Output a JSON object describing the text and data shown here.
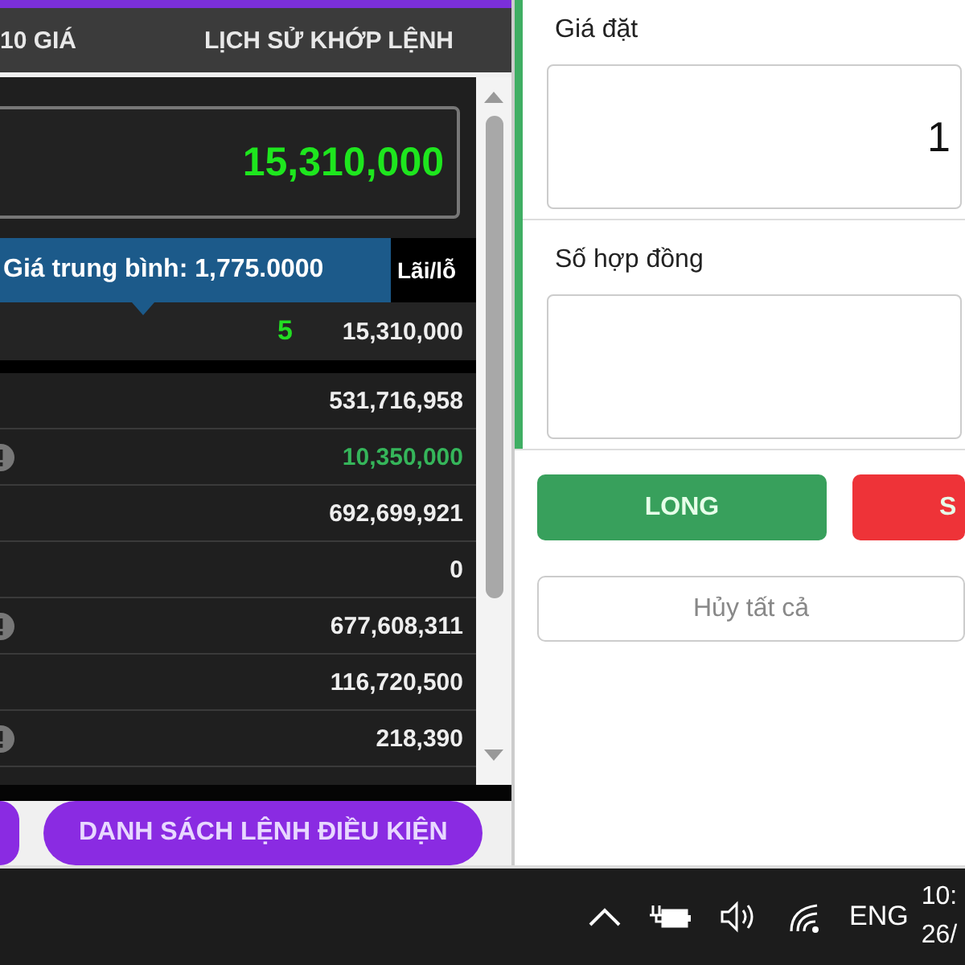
{
  "left_panel": {
    "tabs": [
      {
        "label": "10 GIÁ"
      },
      {
        "label": "LỊCH SỬ KHỚP LỆNH"
      }
    ],
    "total_value": "15,310,000",
    "tooltip": "Giá trung bình: 1,775.0000",
    "column_header": "Lãi/lỗ",
    "position_row": {
      "quantity": "5",
      "value": "15,310,000"
    },
    "rows": [
      {
        "info": false,
        "value": "531,716,958",
        "kind": "plain"
      },
      {
        "info": true,
        "value": "10,350,000",
        "kind": "gain"
      },
      {
        "info": false,
        "value": "692,699,921",
        "kind": "plain"
      },
      {
        "info": false,
        "value": "0",
        "kind": "plain"
      },
      {
        "info": true,
        "value": "677,608,311",
        "kind": "plain"
      },
      {
        "info": false,
        "value": "116,720,500",
        "kind": "plain"
      },
      {
        "info": true,
        "value": "218,390",
        "kind": "plain"
      }
    ],
    "buttons": [
      "DANH SÁCH LỆNH ĐIỀU KIỆN"
    ]
  },
  "order_form": {
    "price_label": "Giá đặt",
    "price_value": "1",
    "contracts_label": "Số hợp đồng",
    "long_button": "LONG",
    "short_button": "S",
    "cancel_button": "Hủy tất cả"
  },
  "taskbar": {
    "language": "ENG",
    "time": "10:",
    "date": "26/"
  }
}
